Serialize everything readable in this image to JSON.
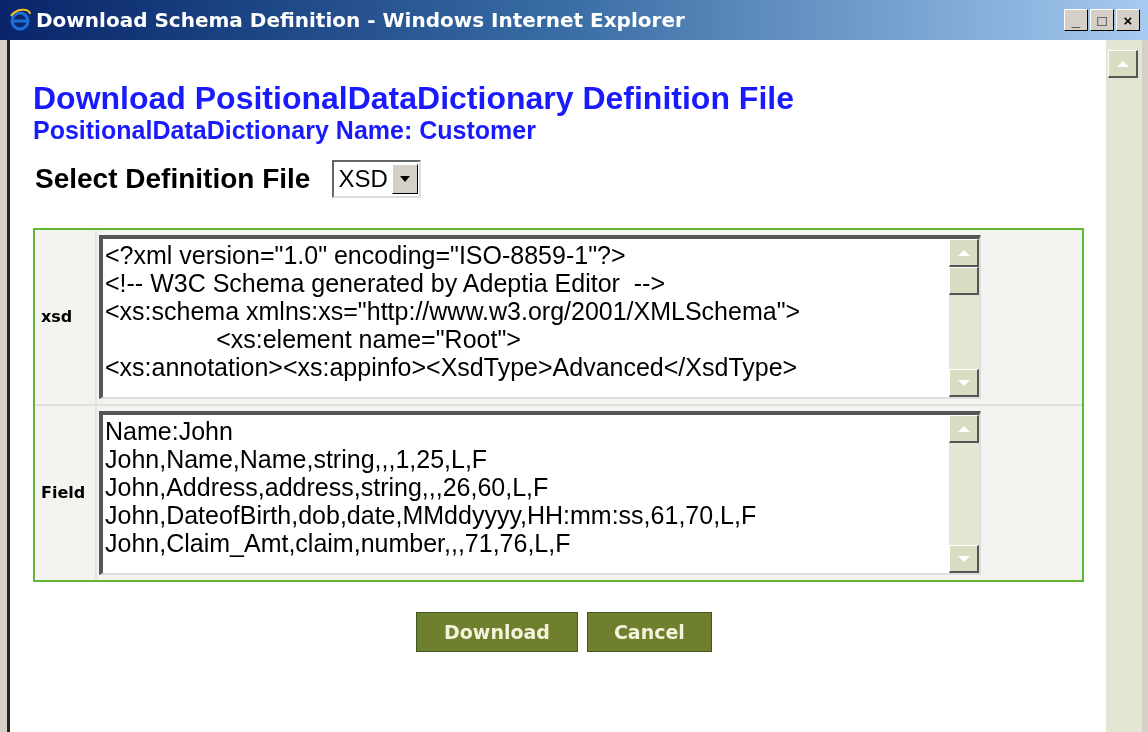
{
  "window": {
    "title": "Download Schema Definition - Windows Internet Explorer",
    "controls": [
      "_",
      "□",
      "×"
    ]
  },
  "heading": "Download PositionalDataDictionary Definition File",
  "subheading": "PositionalDataDictionary Name: Customer",
  "select": {
    "label": "Select Definition File",
    "value": "XSD"
  },
  "rows": [
    {
      "label": "xsd",
      "lines": [
        "<?xml version=\"1.0\" encoding=\"ISO-8859-1\"?>",
        "<!-- W3C Schema generated by Adeptia Editor  -->",
        "<xs:schema xmlns:xs=\"http://www.w3.org/2001/XMLSchema\">",
        "\t\t<xs:element name=\"Root\">",
        "<xs:annotation><xs:appinfo><XsdType>Advanced</XsdType>"
      ],
      "thumb": true
    },
    {
      "label": "Field",
      "lines": [
        "Name:John",
        "John,Name,Name,string,,,1,25,L,F",
        "John,Address,address,string,,,26,60,L,F",
        "John,DateofBirth,dob,date,MMddyyyy,HH:mm:ss,61,70,L,F",
        "John,Claim_Amt,claim,number,,,71,76,L,F"
      ],
      "thumb": false
    }
  ],
  "buttons": [
    "Download",
    "Cancel"
  ]
}
